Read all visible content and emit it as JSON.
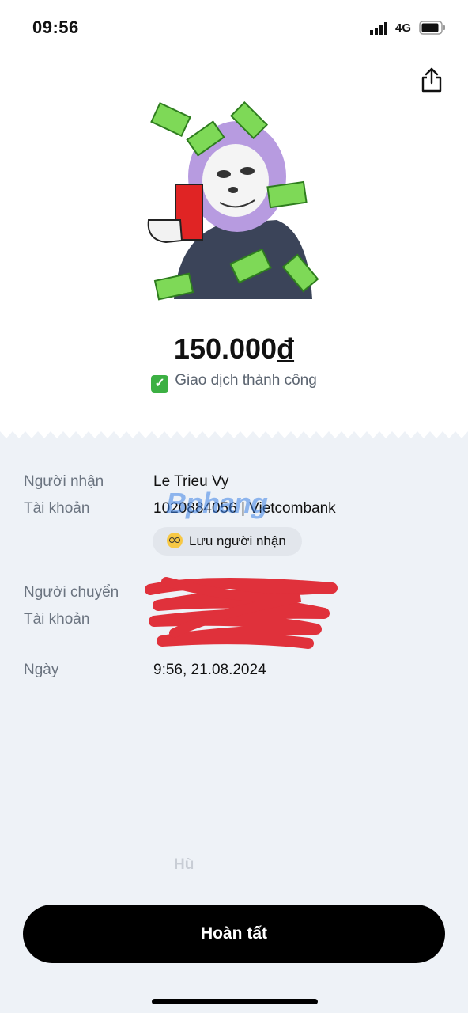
{
  "status_bar": {
    "time": "09:56",
    "network": "4G"
  },
  "transaction": {
    "amount": "150.000",
    "currency": "đ",
    "status": "Giao dịch thành công"
  },
  "recipient": {
    "label_name": "Người nhận",
    "name": "Le Trieu Vy",
    "label_account": "Tài khoản",
    "account": "1020884056 | Vietcombank",
    "save_label": "Lưu người nhận"
  },
  "sender": {
    "label_name": "Người chuyển",
    "label_account": "Tài khoản"
  },
  "date": {
    "label": "Ngày",
    "value": "9:56, 21.08.2024"
  },
  "watermark": "Bphang",
  "faint_text": "Hù",
  "done_label": "Hoàn tất",
  "colors": {
    "accent": "#000000",
    "success": "#3cb043",
    "background": "#eef2f7"
  }
}
